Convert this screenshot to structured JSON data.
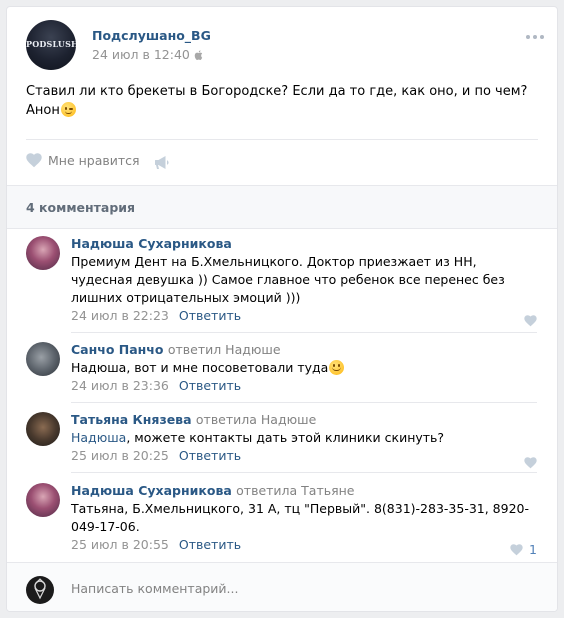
{
  "post": {
    "author": "Подслушано_BG",
    "avatar_logo_text": "PODSLUSHANO",
    "date": "24 июл в 12:40",
    "text_line1": "Ставил ли кто брекеты в Богородске? Если да то где, как оно, и по чем?",
    "text_line2": "Анон",
    "like_label": "Мне нравится"
  },
  "comments_header": {
    "count_label": "4 комментария"
  },
  "comments": [
    {
      "author": "Надюша Сухарникова",
      "reply_to": "",
      "mention": "",
      "text": "Премиум Дент на Б.Хмельницкого. Доктор приезжает из НН, чудесная девушка )) Самое главное что ребенок все перенес без лишних отрицательных эмоций )))",
      "date": "24 июл в 22:23",
      "reply_label": "Ответить",
      "likes": ""
    },
    {
      "author": "Санчо Панчо",
      "reply_to": "ответил Надюше",
      "mention": "",
      "text": "Надюша, вот и мне посоветовали туда",
      "date": "24 июл в 23:36",
      "reply_label": "Ответить",
      "likes": ""
    },
    {
      "author": "Татьяна Князева",
      "reply_to": "ответила Надюше",
      "mention": "Надюша",
      "text": ", можете контакты дать этой клиники скинуть?",
      "date": "25 июл в 20:25",
      "reply_label": "Ответить",
      "likes": ""
    },
    {
      "author": "Надюша Сухарникова",
      "reply_to": "ответила Татьяне",
      "mention": "",
      "text": "Татьяна, Б.Хмельницкого, 31 А, тц \"Первый\". 8(831)-283-35-31, 8920-049-17-06.",
      "date": "25 июл в 20:55",
      "reply_label": "Ответить",
      "likes": "1"
    }
  ],
  "write": {
    "placeholder": "Написать комментарий..."
  },
  "colors": {
    "link": "#2a5885",
    "muted": "#939393",
    "like_blue": "#5181b8",
    "background": "#edeef0"
  }
}
